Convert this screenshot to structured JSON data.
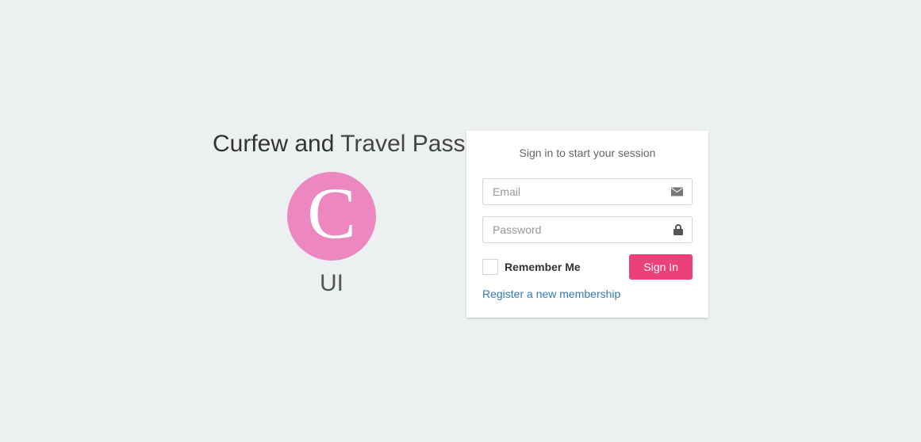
{
  "app": {
    "title_bold": "Curfew and",
    "title_light": "Travel Pass",
    "logo_letter": "C",
    "subtitle": "UI"
  },
  "login": {
    "message": "Sign in to start your session",
    "email_placeholder": "Email",
    "password_placeholder": "Password",
    "remember_label": "Remember Me",
    "signin_label": "Sign In",
    "register_label": "Register a new membership"
  }
}
